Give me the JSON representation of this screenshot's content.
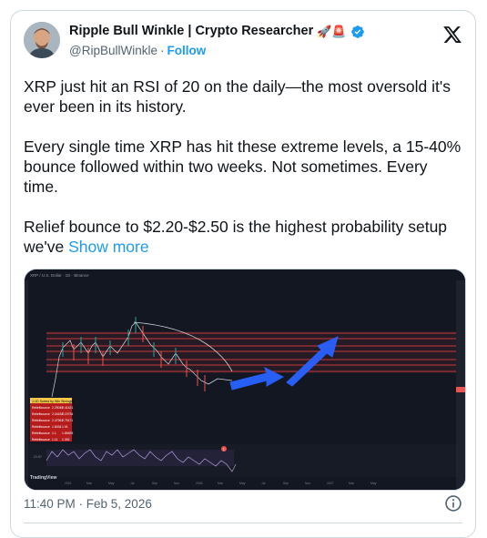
{
  "tweet": {
    "author": {
      "display_name": "Ripple Bull Winkle | Crypto Researcher",
      "emojis": "🚀🚨",
      "handle": "@RipBullWinkle",
      "separator": "·",
      "follow_label": "Follow",
      "verified": true
    },
    "paragraphs": [
      "XRP just hit an RSI of 20 on the daily—the most oversold it's ever been in its history.",
      "Every single time XRP has hit these extreme levels, a 15-40% bounce followed within two weeks. Not sometimes. Every time."
    ],
    "last_paragraph": "Relief bounce to $2.20-$2.50 is the highest probability setup we've",
    "show_more_label": "Show more",
    "timestamp": "11:40 PM · Feb 5, 2026",
    "icons": {
      "platform": "x-logo-icon",
      "info": "info-icon",
      "verified": "verified-badge-icon"
    },
    "colors": {
      "link": "#1d9bf0",
      "text": "#0f1419",
      "muted": "#536471",
      "chart_bg": "#131722",
      "resistance_bands": "#b2383b",
      "arrow": "#2962ff"
    },
    "media": {
      "chart_header": "XRP / U.S. Dollar · 1D · Binance",
      "watermark": "TradingView",
      "months": [
        "2021",
        "Mar",
        "May",
        "Jul",
        "Sep",
        "Nov",
        "2026",
        "Mar",
        "May",
        "Jul",
        "Sep",
        "Nov",
        "2027",
        "Mar",
        "May"
      ],
      "table_title": "1:1D Sorted by Win Strength",
      "table_rows": [
        [
          "Reliefbounce",
          "2.29049",
          "2.41421"
        ],
        [
          "Reliefbounce",
          "2.04433",
          "2.19734"
        ],
        [
          "Reliefbounce",
          "2.47961",
          "2.79171"
        ],
        [
          "Reliefbounce",
          "1.8034",
          "1.91"
        ],
        [
          "Reliefbounce",
          "1.1",
          "1.69493"
        ],
        [
          "Reliefbounce",
          "1.11",
          "1.392"
        ]
      ],
      "rsi_value": "21.97",
      "marker": "1"
    }
  }
}
